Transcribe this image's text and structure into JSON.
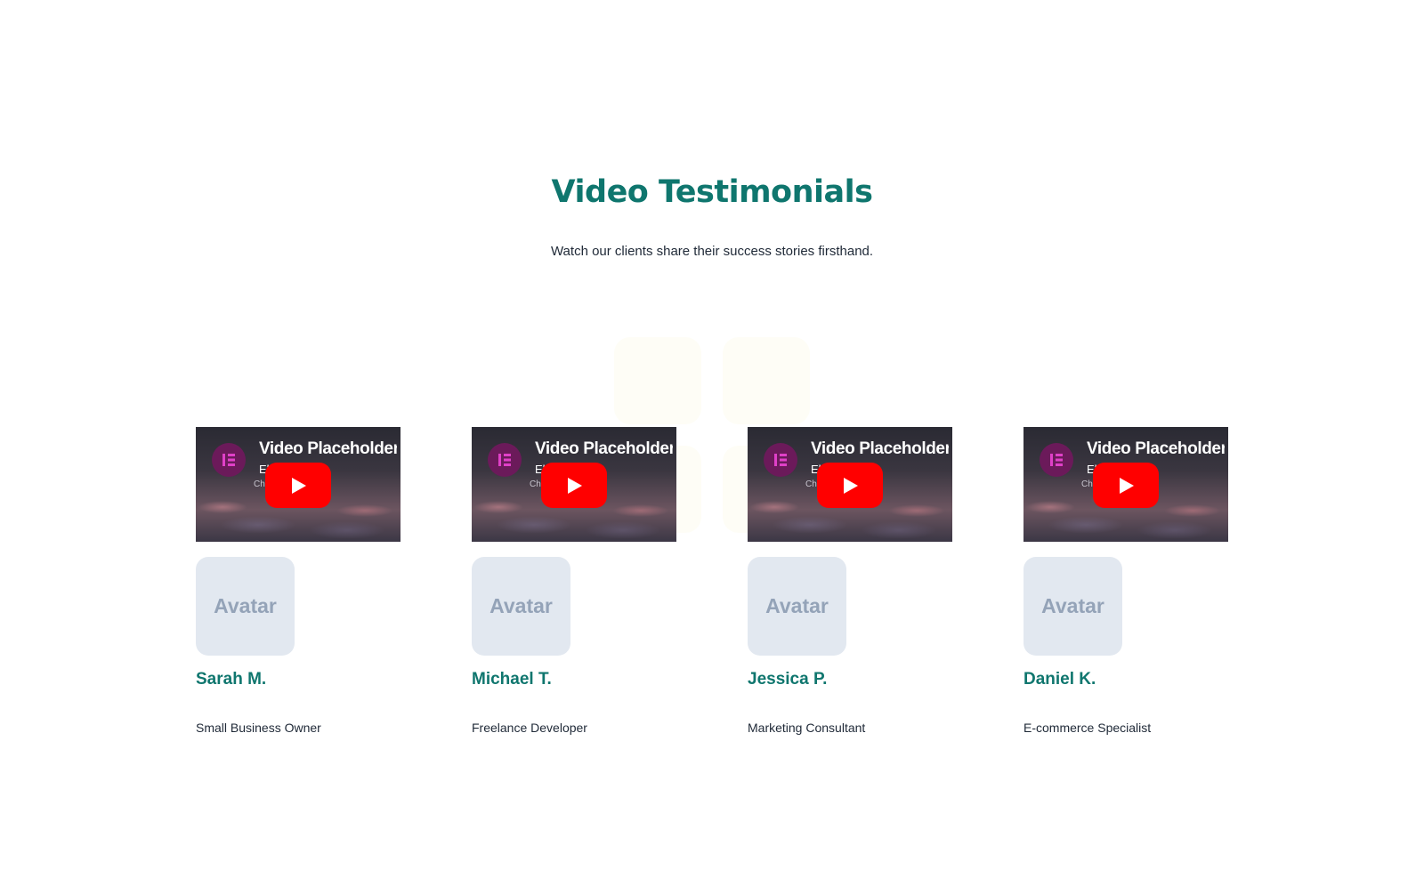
{
  "section": {
    "title": "Video Testimonials",
    "subtitle": "Watch our clients share their success stories firsthand."
  },
  "video": {
    "title": "Video Placeholder",
    "channel": "Elementor",
    "subtitle": "Channel · Video"
  },
  "avatar_label": "Avatar",
  "testimonials": [
    {
      "name": "Sarah M.",
      "role": "Small Business Owner"
    },
    {
      "name": "Michael T.",
      "role": "Freelance Developer"
    },
    {
      "name": "Jessica P.",
      "role": "Marketing Consultant"
    },
    {
      "name": "Daniel K.",
      "role": "E-commerce Specialist"
    }
  ],
  "colors": {
    "accent": "#0f766e",
    "youtube_red": "#ff0000",
    "avatar_bg": "#e2e8f0",
    "avatar_text": "#94a3b8",
    "channel_logo": "#6b1a5a",
    "logo_mark": "#e040c8"
  },
  "icons": {
    "channel_logo": "elementor-logo-icon",
    "play": "youtube-play-icon"
  }
}
